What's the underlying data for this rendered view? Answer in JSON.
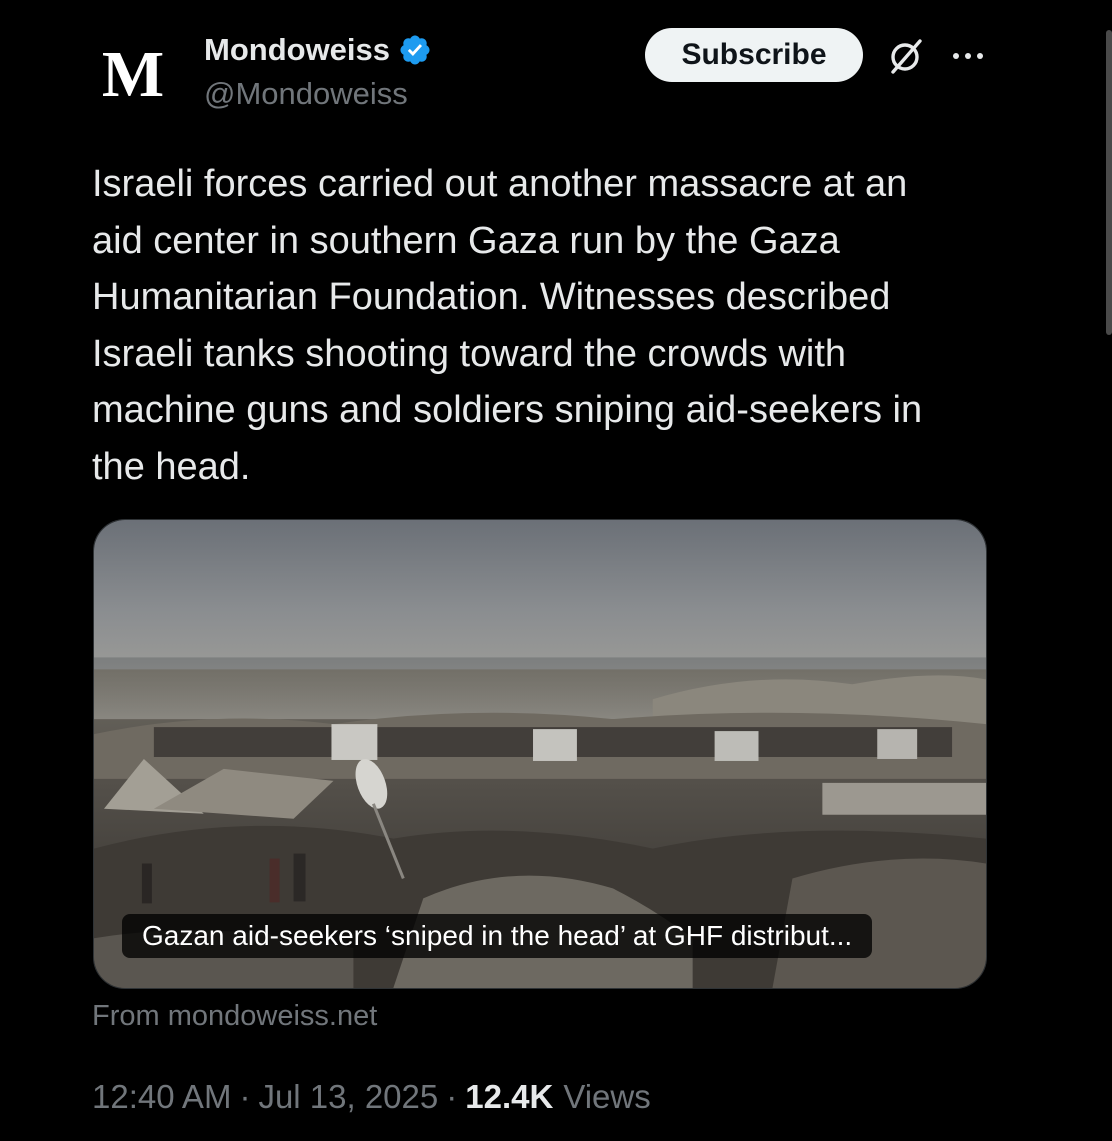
{
  "author": {
    "avatar_letter": "M",
    "display_name": "Mondoweiss",
    "handle": "@Mondoweiss",
    "verified": true
  },
  "actions": {
    "subscribe_label": "Subscribe",
    "grok_icon": "grok-icon",
    "more_icon": "more-icon"
  },
  "tweet": {
    "text": "Israeli forces carried out another massacre at an\naid center in southern Gaza run by the Gaza\nHumanitarian Foundation. Witnesses described\nIsraeli tanks shooting toward the crowds with\nmachine guns and soldiers sniping aid-seekers in\nthe head."
  },
  "link_card": {
    "title": "Gazan aid-seekers ‘sniped in the head’ at GHF distribut...",
    "source": "From mondoweiss.net"
  },
  "meta": {
    "time": "12:40 AM",
    "separator": "·",
    "date": "Jul 13, 2025",
    "views_count": "12.4K",
    "views_label": "Views"
  },
  "colors": {
    "background": "#000000",
    "text_primary": "#e7e9ea",
    "text_secondary": "#71767b",
    "verified_badge": "#1d9bf0",
    "subscribe_bg": "#eff3f4"
  }
}
